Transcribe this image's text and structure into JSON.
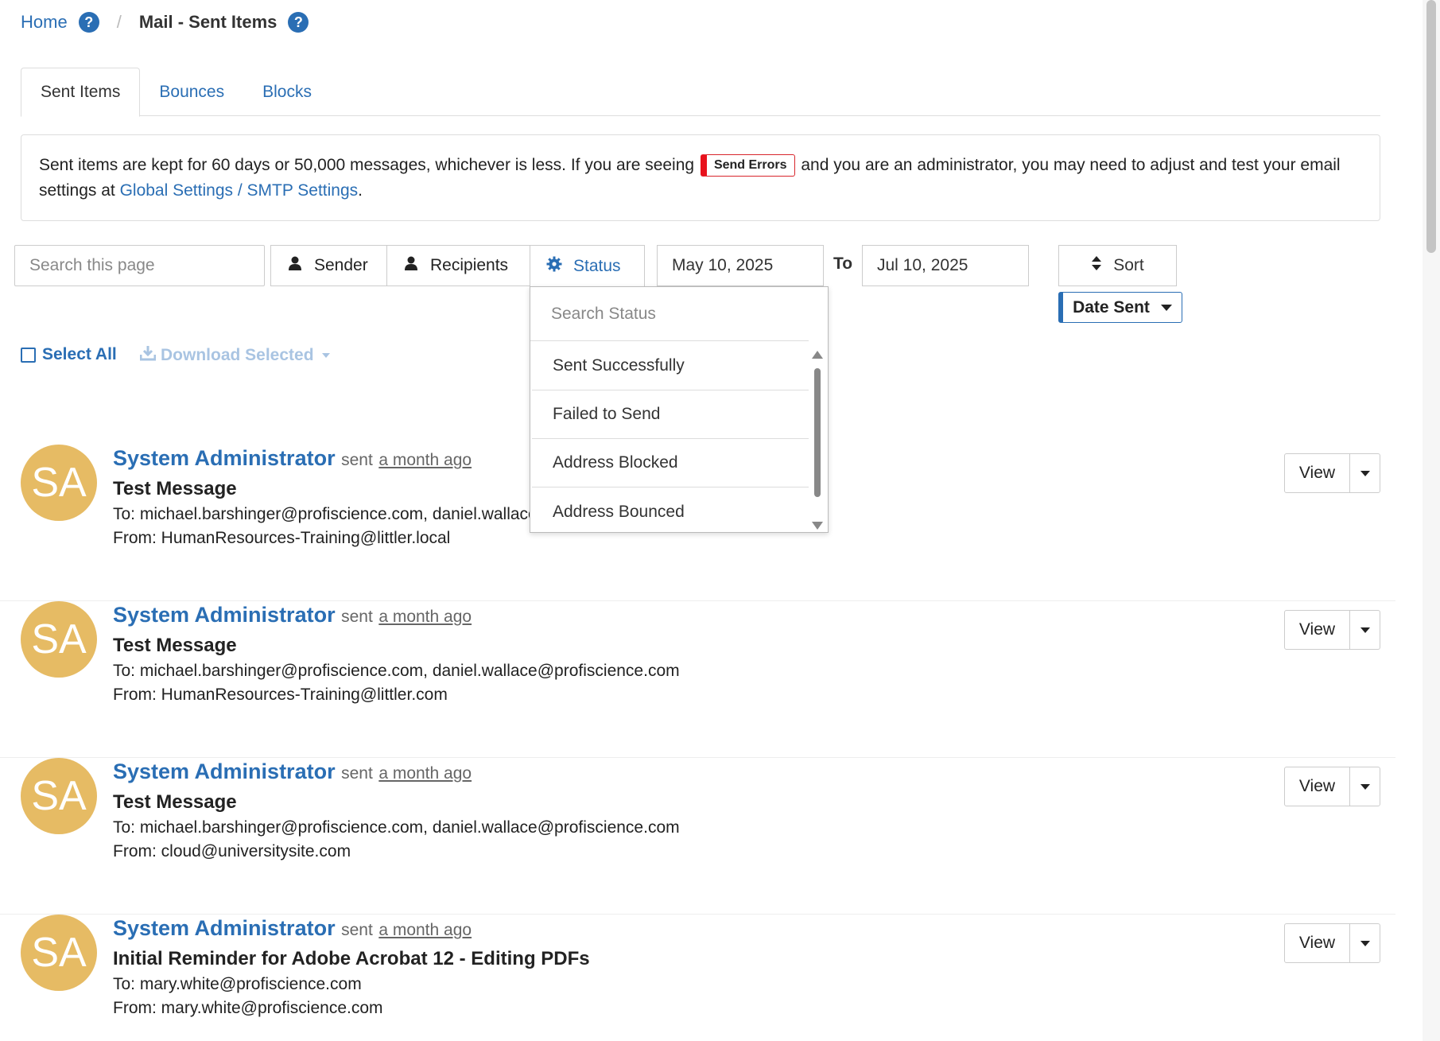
{
  "breadcrumb": {
    "home": "Home",
    "separator": "/",
    "current": "Mail - Sent Items",
    "help_symbol": "?"
  },
  "tabs": [
    {
      "label": "Sent Items",
      "active": true
    },
    {
      "label": "Bounces",
      "active": false
    },
    {
      "label": "Blocks",
      "active": false
    }
  ],
  "notice": {
    "text_before": "Sent items are kept for 60 days or 50,000 messages, whichever is less. If you are seeing",
    "badge": "Send Errors",
    "text_after": "and you are an administrator, you may need to adjust and test your email settings at",
    "link": "Global Settings / SMTP Settings",
    "end": "."
  },
  "filters": {
    "search_placeholder": "Search this page",
    "sender": "Sender",
    "recipients": "Recipients",
    "status": "Status",
    "date_from": "May 10, 2025",
    "to_label": "To",
    "date_to": "Jul 10, 2025",
    "sort": "Sort",
    "sort_field": "Date Sent"
  },
  "status_dropdown": {
    "search_placeholder": "Search Status",
    "options": [
      "Sent Successfully",
      "Failed to Send",
      "Address Blocked",
      "Address Bounced"
    ]
  },
  "bulk": {
    "select_all": "Select All",
    "download": "Download Selected"
  },
  "messages": [
    {
      "initials": "SA",
      "sender": "System Administrator",
      "sent_word": "sent",
      "when": "a month ago",
      "subject": "Test Message",
      "to": "To: michael.barshinger@profiscience.com, daniel.wallace@profiscience.com",
      "from": "From: HumanResources-Training@littler.local",
      "view": "View"
    },
    {
      "initials": "SA",
      "sender": "System Administrator",
      "sent_word": "sent",
      "when": "a month ago",
      "subject": "Test Message",
      "to": "To: michael.barshinger@profiscience.com, daniel.wallace@profiscience.com",
      "from": "From: HumanResources-Training@littler.com",
      "view": "View"
    },
    {
      "initials": "SA",
      "sender": "System Administrator",
      "sent_word": "sent",
      "when": "a month ago",
      "subject": "Test Message",
      "to": "To: michael.barshinger@profiscience.com, daniel.wallace@profiscience.com",
      "from": "From: cloud@universitysite.com",
      "view": "View"
    },
    {
      "initials": "SA",
      "sender": "System Administrator",
      "sent_word": "sent",
      "when": "a month ago",
      "subject": "Initial Reminder for Adobe Acrobat 12 - Editing PDFs",
      "to": "To: mary.white@profiscience.com",
      "from": "From: mary.white@profiscience.com",
      "view": "View"
    }
  ],
  "colors": {
    "link": "#2a6eb4",
    "avatar": "#e6bb64",
    "error": "#e8121c"
  }
}
